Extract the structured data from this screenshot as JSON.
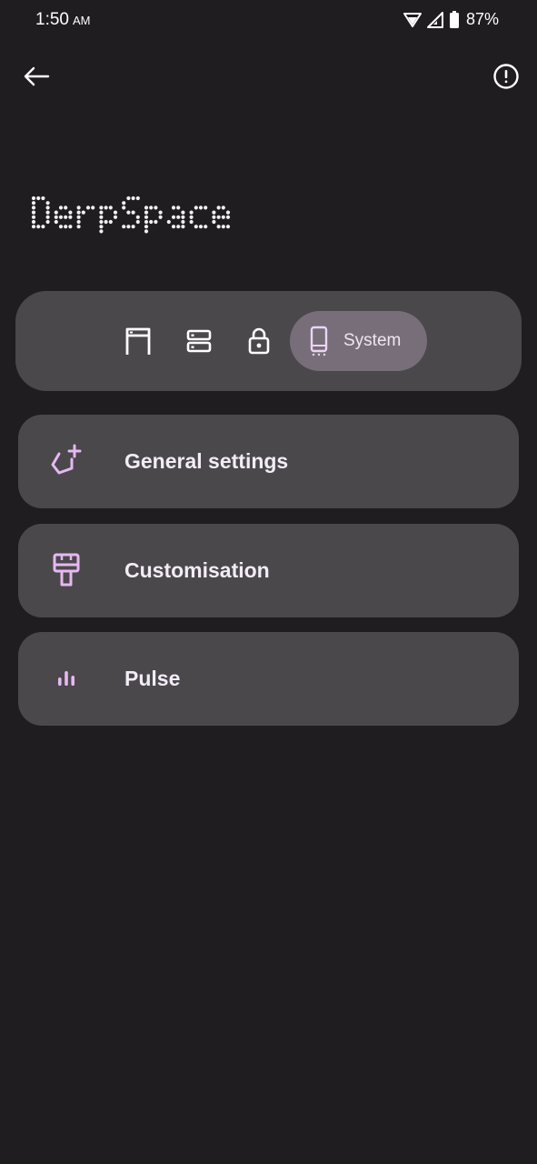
{
  "status_bar": {
    "time": "1:50",
    "ampm": "AM",
    "battery": "87%",
    "icons": [
      "wifi-icon",
      "cellular-signal-icon",
      "battery-icon"
    ]
  },
  "app_bar": {
    "back_icon": "arrow-left-icon",
    "info_icon": "info-circle-icon"
  },
  "logo": {
    "text": "DerpSpace"
  },
  "tabs": [
    {
      "icon": "storefront-icon",
      "label": ""
    },
    {
      "icon": "storage-icon",
      "label": ""
    },
    {
      "icon": "lock-icon",
      "label": ""
    },
    {
      "icon": "phone-icon",
      "label": "System",
      "selected": true
    }
  ],
  "cards": [
    {
      "icon": "general-settings-icon",
      "title": "General settings"
    },
    {
      "icon": "paint-brush-icon",
      "title": "Customisation"
    },
    {
      "icon": "equalizer-icon",
      "title": "Pulse"
    }
  ],
  "colors": {
    "background": "#1f1d20",
    "surface": "#4a484b",
    "selected_tab": "#776e79",
    "accent_icon": "#e6b8f2",
    "text": "#f3ebf6"
  }
}
